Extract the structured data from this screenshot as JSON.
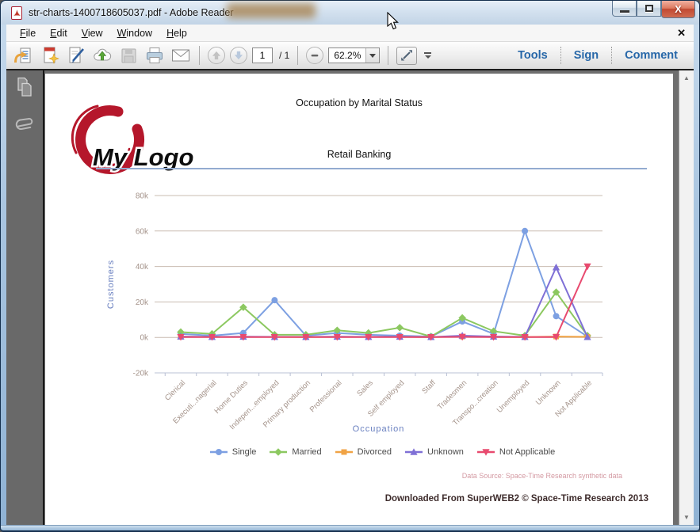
{
  "window": {
    "title": "str-charts-1400718605037.pdf - Adobe Reader",
    "controls": [
      "minimize-icon",
      "restore-icon",
      "close-icon"
    ]
  },
  "menu": {
    "items": [
      {
        "key": "F",
        "rest": "ile"
      },
      {
        "key": "E",
        "rest": "dit"
      },
      {
        "key": "V",
        "rest": "iew"
      },
      {
        "key": "W",
        "rest": "indow"
      },
      {
        "key": "H",
        "rest": "elp"
      }
    ],
    "close_glyph": "✕"
  },
  "toolbar": {
    "icons": [
      "open-file-icon",
      "create-pdf-icon",
      "sign-document-icon",
      "cloud-upload-icon",
      "save-icon",
      "print-icon",
      "email-icon",
      "previous-page-icon",
      "next-page-icon",
      "zoom-out-icon",
      "fit-window-icon",
      "toolbar-overflow-icon"
    ],
    "page_current": "1",
    "page_total": "/ 1",
    "zoom_level": "62.2%",
    "links": [
      "Tools",
      "Sign",
      "Comment"
    ]
  },
  "glyphs": {
    "close": "X",
    "scroll_up": "▲",
    "scroll_down": "▼"
  },
  "document": {
    "title": "Occupation by Marital Status",
    "subtitle": "Retail Banking",
    "logo_text": "My Logo",
    "data_source": "Data Source: Space-Time Research synthetic data",
    "footer": "Downloaded From SuperWEB2 © Space-Time Research 2013"
  },
  "colors": {
    "link_blue": "#2767a8",
    "grid": "#cabcb1",
    "axis_line": "#b9c0d4",
    "tick_label": "#a4938a",
    "axis_title": "#6a80c0",
    "logo_red": "#b5172b",
    "data_source_pink": "#d49aa3"
  },
  "chart_data": {
    "type": "line",
    "title": "Occupation by Marital Status",
    "subtitle": "Retail Banking",
    "xlabel": "Occupation",
    "ylabel": "Customers",
    "y_unit": "thousands (k)",
    "ylim_k": [
      -20,
      80
    ],
    "yticks_k": [
      80,
      60,
      40,
      20,
      0,
      -20
    ],
    "grid": true,
    "legend_position": "bottom",
    "categories": [
      "Clerical",
      "Executi...nagerial",
      "Home Duties",
      "Indepen...employed",
      "Primary production",
      "Professional",
      "Sales",
      "Self employed",
      "Staff",
      "Tradesmen",
      "Transpo...creation",
      "Unemployed",
      "Unknown",
      "Not Applicable"
    ],
    "series": [
      {
        "name": "Single",
        "color": "#7da0e2",
        "marker": "circle",
        "values_k": [
          2,
          1,
          2.5,
          21,
          1,
          2.5,
          1.5,
          1,
          0.5,
          9,
          2,
          60,
          12,
          0.5
        ]
      },
      {
        "name": "Married",
        "color": "#8cc860",
        "marker": "diamond",
        "values_k": [
          3,
          2,
          17,
          1.5,
          1.5,
          4,
          2.5,
          5.5,
          0.5,
          11,
          3.5,
          1,
          25.5,
          1
        ]
      },
      {
        "name": "Divorced",
        "color": "#f0a345",
        "marker": "square",
        "values_k": [
          0.3,
          0.3,
          0.3,
          0.3,
          0.2,
          0.3,
          0.3,
          0.3,
          0.2,
          0.5,
          0.3,
          0.2,
          0.5,
          0.3
        ]
      },
      {
        "name": "Unknown",
        "color": "#7f70d6",
        "marker": "triangle",
        "values_k": [
          0.5,
          0.3,
          0.4,
          0.3,
          0.3,
          0.4,
          0.3,
          0.4,
          0.2,
          1,
          0.5,
          0.3,
          39.5,
          0.2
        ]
      },
      {
        "name": "Not Applicable",
        "color": "#e84a6f",
        "marker": "triangle-down",
        "values_k": [
          0.2,
          0.2,
          0.2,
          0.2,
          0.2,
          0.2,
          0.2,
          0.2,
          0.2,
          0.3,
          0.2,
          0.2,
          0.2,
          40
        ]
      }
    ]
  }
}
